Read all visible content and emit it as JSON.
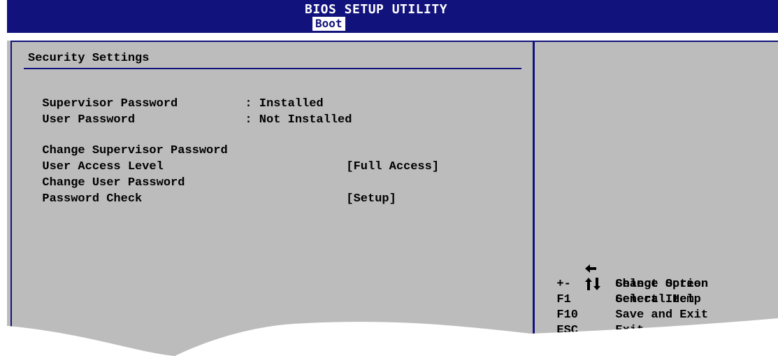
{
  "header": {
    "title": "BIOS SETUP UTILITY",
    "active_tab": "Boot"
  },
  "section": {
    "title": "Security Settings"
  },
  "status": [
    {
      "label": "Supervisor Password",
      "value": ": Installed"
    },
    {
      "label": "User Password",
      "value": ": Not Installed"
    }
  ],
  "options": [
    {
      "label": "Change Supervisor Password",
      "value": ""
    },
    {
      "label": "User Access Level",
      "value": "[Full Access]"
    },
    {
      "label": "Change User Password",
      "value": ""
    },
    {
      "label": "Password Check",
      "value": "[Setup]"
    }
  ],
  "help": [
    {
      "key_icon": "left-arrow-icon",
      "key": "",
      "desc": "Select Screen"
    },
    {
      "key_icon": "up-down-arrows-icon",
      "key": "",
      "desc": "Select Item"
    },
    {
      "key_icon": "",
      "key": "+-",
      "desc": "Change Option"
    },
    {
      "key_icon": "",
      "key": "F1",
      "desc": "General Help"
    },
    {
      "key_icon": "",
      "key": "F10",
      "desc": "Save and Exit"
    },
    {
      "key_icon": "",
      "key": "ESC",
      "desc": "Exit"
    }
  ],
  "colors": {
    "header_bg": "#12127c",
    "panel_bg": "#bcbcbc",
    "text": "#000000",
    "title_text": "#ffffff"
  }
}
